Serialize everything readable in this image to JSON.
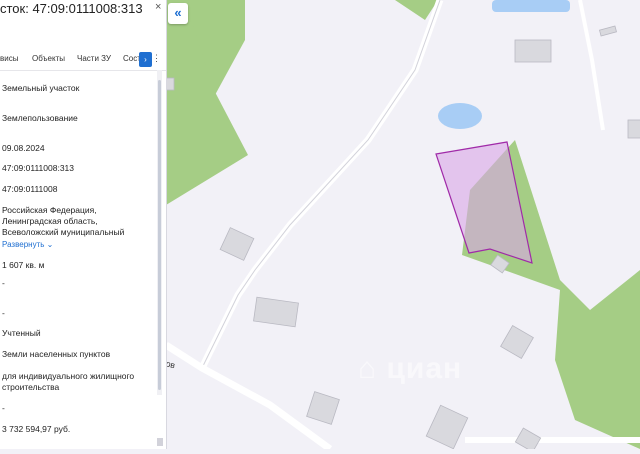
{
  "panel": {
    "title": "сток: 47:09:0111008:313",
    "close": "×",
    "tabs": [
      "висы",
      "Объекты",
      "Части ЗУ",
      "Сост"
    ],
    "tab_next": "›",
    "tab_more": "⋮",
    "fields": [
      "Земельный участок",
      "Землепользование",
      "09.08.2024",
      "47:09:0111008:313",
      "47:09:0111008",
      "Российская Федерация,",
      "Ленинградская область,",
      "Всеволожский муниципальный",
      "1 607 кв. м",
      "-",
      "-",
      "Учтенный",
      "Земли населенных пунктов",
      "для индивидуального жилищного",
      "строительства",
      "-",
      "3 732 594,97 руб."
    ],
    "expand_label": "Развернуть ⌄"
  },
  "map": {
    "collapse_label": "«",
    "street_label": "атаров",
    "watermark": "⌂ циан",
    "colors": {
      "background": "#f2f1f7",
      "greenery": "#a5cd85",
      "water": "#a8cdf5",
      "road": "#ffffff",
      "building": "#d9d9de",
      "parcel_fill": "#d9a6e6",
      "parcel_stroke": "#a02aa8"
    }
  }
}
